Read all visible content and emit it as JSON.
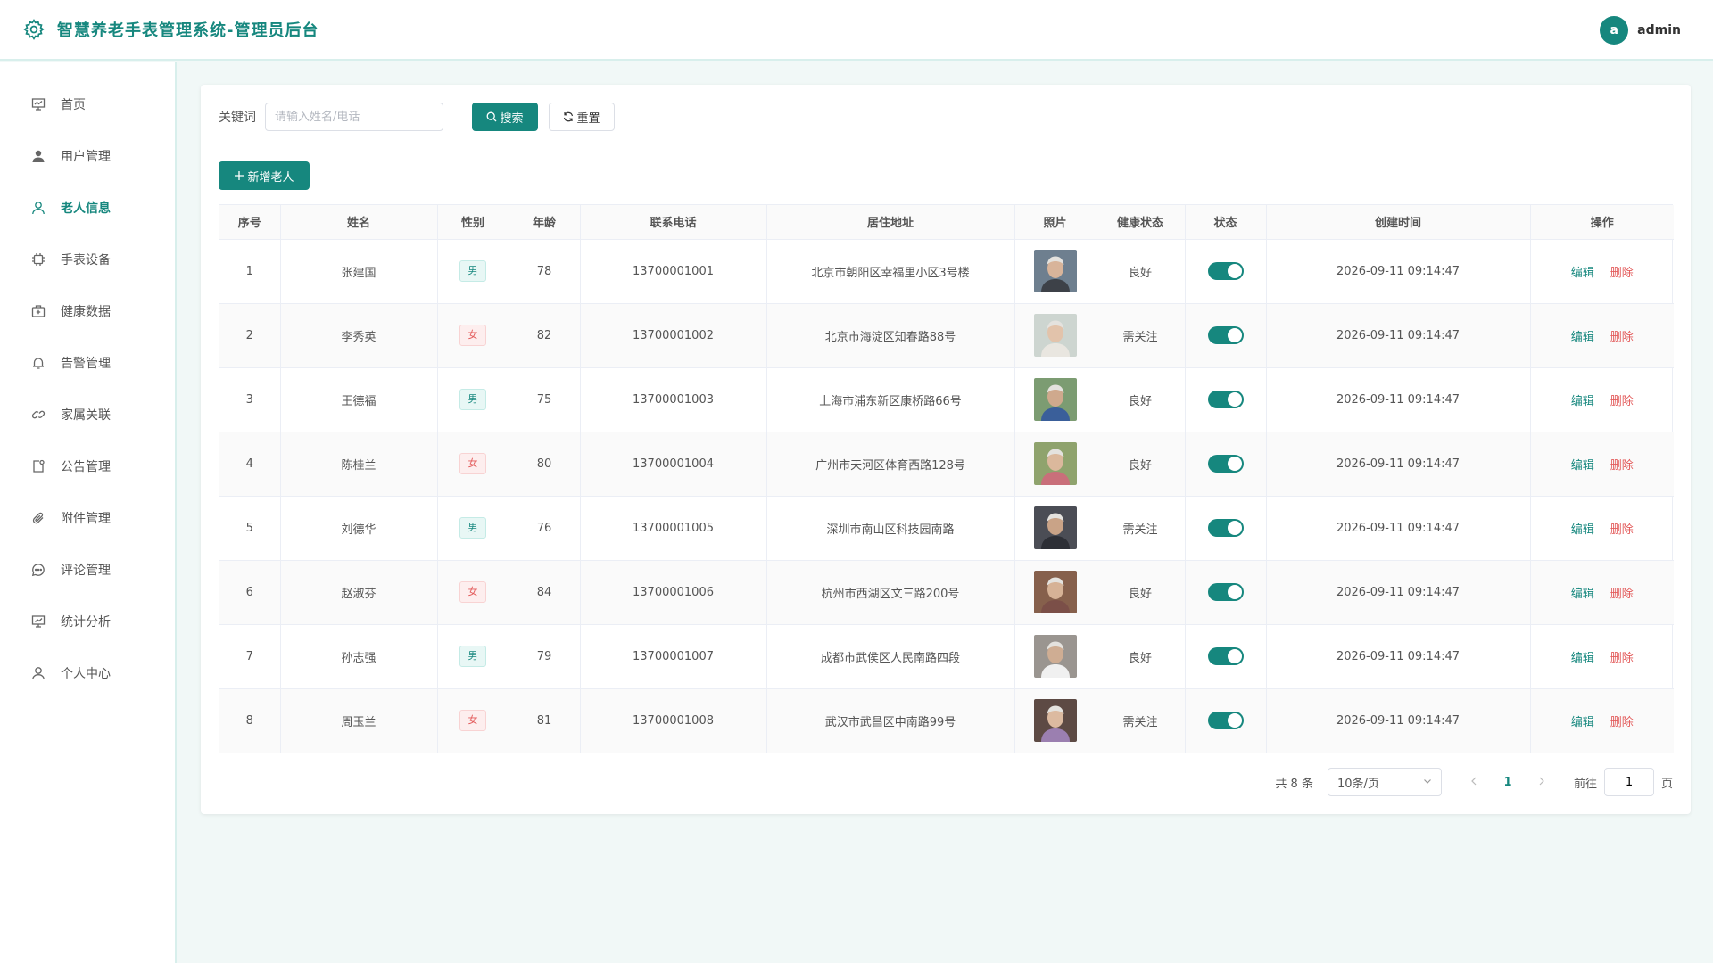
{
  "header": {
    "title": "智慧养老手表管理系统-管理员后台",
    "logo_icon": "gear-icon",
    "avatar_letter": "a",
    "username": "admin"
  },
  "sidebar": {
    "items": [
      {
        "label": "首页",
        "icon": "presentation-icon"
      },
      {
        "label": "用户管理",
        "icon": "user-filled-icon"
      },
      {
        "label": "老人信息",
        "icon": "user-icon",
        "active": true
      },
      {
        "label": "手表设备",
        "icon": "chip-icon"
      },
      {
        "label": "健康数据",
        "icon": "medical-box-icon"
      },
      {
        "label": "告警管理",
        "icon": "bell-icon"
      },
      {
        "label": "家属关联",
        "icon": "link-icon"
      },
      {
        "label": "公告管理",
        "icon": "notice-icon"
      },
      {
        "label": "附件管理",
        "icon": "paperclip-icon"
      },
      {
        "label": "评论管理",
        "icon": "chat-icon"
      },
      {
        "label": "统计分析",
        "icon": "chart-board-icon"
      },
      {
        "label": "个人中心",
        "icon": "user-icon"
      }
    ]
  },
  "search": {
    "label": "关键词",
    "placeholder": "请输入姓名/电话",
    "search_button": "搜索",
    "reset_button": "重置"
  },
  "add_button": "新增老人",
  "table": {
    "columns": [
      "序号",
      "姓名",
      "性别",
      "年龄",
      "联系电话",
      "居住地址",
      "照片",
      "健康状态",
      "状态",
      "创建时间",
      "操作"
    ],
    "rows": [
      {
        "no": "1",
        "name": "张建国",
        "gender": "男",
        "age": "78",
        "phone": "13700001001",
        "address": "北京市朝阳区幸福里小区3号楼",
        "health": "良好",
        "enabled": true,
        "created": "2026-09-11 09:14:47"
      },
      {
        "no": "2",
        "name": "李秀英",
        "gender": "女",
        "age": "82",
        "phone": "13700001002",
        "address": "北京市海淀区知春路88号",
        "health": "需关注",
        "enabled": true,
        "created": "2026-09-11 09:14:47"
      },
      {
        "no": "3",
        "name": "王德福",
        "gender": "男",
        "age": "75",
        "phone": "13700001003",
        "address": "上海市浦东新区康桥路66号",
        "health": "良好",
        "enabled": true,
        "created": "2026-09-11 09:14:47"
      },
      {
        "no": "4",
        "name": "陈桂兰",
        "gender": "女",
        "age": "80",
        "phone": "13700001004",
        "address": "广州市天河区体育西路128号",
        "health": "良好",
        "enabled": true,
        "created": "2026-09-11 09:14:47"
      },
      {
        "no": "5",
        "name": "刘德华",
        "gender": "男",
        "age": "76",
        "phone": "13700001005",
        "address": "深圳市南山区科技园南路",
        "health": "需关注",
        "enabled": true,
        "created": "2026-09-11 09:14:47"
      },
      {
        "no": "6",
        "name": "赵淑芬",
        "gender": "女",
        "age": "84",
        "phone": "13700001006",
        "address": "杭州市西湖区文三路200号",
        "health": "良好",
        "enabled": true,
        "created": "2026-09-11 09:14:47"
      },
      {
        "no": "7",
        "name": "孙志强",
        "gender": "男",
        "age": "79",
        "phone": "13700001007",
        "address": "成都市武侯区人民南路四段",
        "health": "良好",
        "enabled": true,
        "created": "2026-09-11 09:14:47"
      },
      {
        "no": "8",
        "name": "周玉兰",
        "gender": "女",
        "age": "81",
        "phone": "13700001008",
        "address": "武汉市武昌区中南路99号",
        "health": "需关注",
        "enabled": true,
        "created": "2026-09-11 09:14:47"
      }
    ],
    "edit_label": "编辑",
    "delete_label": "删除"
  },
  "pagination": {
    "total_text": "共 8 条",
    "page_size": "10条/页",
    "current_page": "1",
    "goto_label": "前往",
    "goto_value": "1",
    "goto_suffix": "页"
  },
  "colors": {
    "primary": "#16877e",
    "danger": "#e35b5b",
    "background": "#f1f8f7"
  }
}
